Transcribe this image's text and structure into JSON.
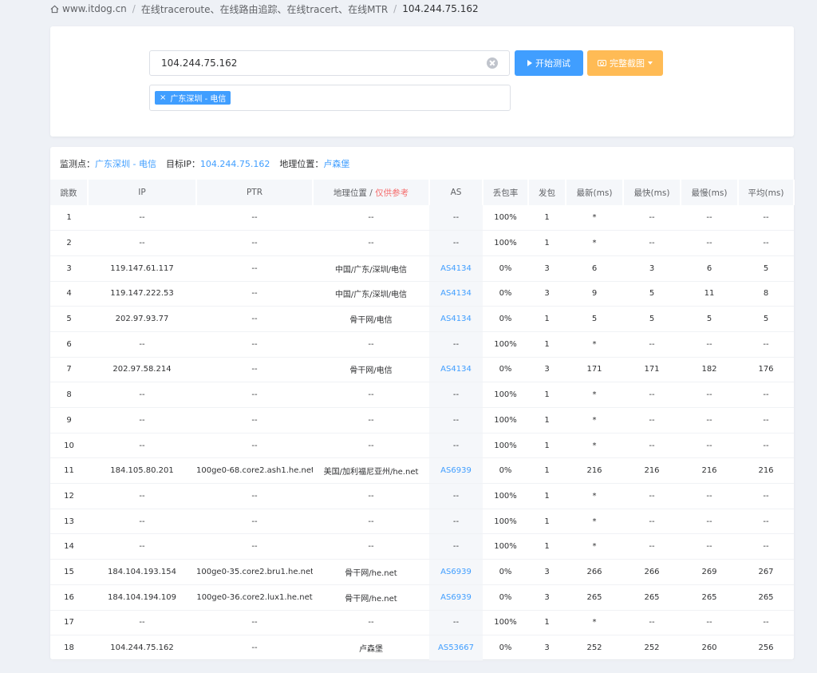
{
  "breadcrumb": {
    "home": "www.itdog.cn",
    "section": "在线traceroute、在线路由追踪、在线tracert、在线MTR",
    "current": "104.244.75.162"
  },
  "search": {
    "value": "104.244.75.162"
  },
  "buttons": {
    "start": "开始测试",
    "screenshot": "完整截图"
  },
  "selected_node": "广东深圳 - 电信",
  "info": {
    "node_label": "监测点：",
    "node_value": "广东深圳 - 电信",
    "target_label": "目标IP：",
    "target_value": "104.244.75.162",
    "geo_label": "地理位置：",
    "geo_value": "卢森堡"
  },
  "table": {
    "headers": {
      "hop": "跳数",
      "ip": "IP",
      "ptr": "PTR",
      "geo": "地理位置 / ",
      "geo_note": "仅供参考",
      "as": "AS",
      "loss": "丢包率",
      "sent": "发包",
      "last": "最新(ms)",
      "best": "最快(ms)",
      "worst": "最慢(ms)",
      "avg": "平均(ms)"
    },
    "rows": [
      {
        "hop": "1",
        "ip": "--",
        "ptr": "--",
        "geo": "--",
        "as": "--",
        "loss": "100%",
        "sent": "1",
        "last": "*",
        "best": "--",
        "worst": "--",
        "avg": "--"
      },
      {
        "hop": "2",
        "ip": "--",
        "ptr": "--",
        "geo": "--",
        "as": "--",
        "loss": "100%",
        "sent": "1",
        "last": "*",
        "best": "--",
        "worst": "--",
        "avg": "--"
      },
      {
        "hop": "3",
        "ip": "119.147.61.117",
        "ptr": "--",
        "geo": "中国/广东/深圳/电信",
        "as": "AS4134",
        "loss": "0%",
        "sent": "3",
        "last": "6",
        "best": "3",
        "worst": "6",
        "avg": "5"
      },
      {
        "hop": "4",
        "ip": "119.147.222.53",
        "ptr": "--",
        "geo": "中国/广东/深圳/电信",
        "as": "AS4134",
        "loss": "0%",
        "sent": "3",
        "last": "9",
        "best": "5",
        "worst": "11",
        "avg": "8"
      },
      {
        "hop": "5",
        "ip": "202.97.93.77",
        "ptr": "--",
        "geo": "骨干网/电信",
        "as": "AS4134",
        "loss": "0%",
        "sent": "1",
        "last": "5",
        "best": "5",
        "worst": "5",
        "avg": "5"
      },
      {
        "hop": "6",
        "ip": "--",
        "ptr": "--",
        "geo": "--",
        "as": "--",
        "loss": "100%",
        "sent": "1",
        "last": "*",
        "best": "--",
        "worst": "--",
        "avg": "--"
      },
      {
        "hop": "7",
        "ip": "202.97.58.214",
        "ptr": "--",
        "geo": "骨干网/电信",
        "as": "AS4134",
        "loss": "0%",
        "sent": "3",
        "last": "171",
        "best": "171",
        "worst": "182",
        "avg": "176"
      },
      {
        "hop": "8",
        "ip": "--",
        "ptr": "--",
        "geo": "--",
        "as": "--",
        "loss": "100%",
        "sent": "1",
        "last": "*",
        "best": "--",
        "worst": "--",
        "avg": "--"
      },
      {
        "hop": "9",
        "ip": "--",
        "ptr": "--",
        "geo": "--",
        "as": "--",
        "loss": "100%",
        "sent": "1",
        "last": "*",
        "best": "--",
        "worst": "--",
        "avg": "--"
      },
      {
        "hop": "10",
        "ip": "--",
        "ptr": "--",
        "geo": "--",
        "as": "--",
        "loss": "100%",
        "sent": "1",
        "last": "*",
        "best": "--",
        "worst": "--",
        "avg": "--"
      },
      {
        "hop": "11",
        "ip": "184.105.80.201",
        "ptr": "100ge0-68.core2.ash1.he.net",
        "geo": "美国/加利福尼亚州/he.net",
        "as": "AS6939",
        "loss": "0%",
        "sent": "1",
        "last": "216",
        "best": "216",
        "worst": "216",
        "avg": "216"
      },
      {
        "hop": "12",
        "ip": "--",
        "ptr": "--",
        "geo": "--",
        "as": "--",
        "loss": "100%",
        "sent": "1",
        "last": "*",
        "best": "--",
        "worst": "--",
        "avg": "--"
      },
      {
        "hop": "13",
        "ip": "--",
        "ptr": "--",
        "geo": "--",
        "as": "--",
        "loss": "100%",
        "sent": "1",
        "last": "*",
        "best": "--",
        "worst": "--",
        "avg": "--"
      },
      {
        "hop": "14",
        "ip": "--",
        "ptr": "--",
        "geo": "--",
        "as": "--",
        "loss": "100%",
        "sent": "1",
        "last": "*",
        "best": "--",
        "worst": "--",
        "avg": "--"
      },
      {
        "hop": "15",
        "ip": "184.104.193.154",
        "ptr": "100ge0-35.core2.bru1.he.net",
        "geo": "骨干网/he.net",
        "as": "AS6939",
        "loss": "0%",
        "sent": "3",
        "last": "266",
        "best": "266",
        "worst": "269",
        "avg": "267"
      },
      {
        "hop": "16",
        "ip": "184.104.194.109",
        "ptr": "100ge0-36.core2.lux1.he.net",
        "geo": "骨干网/he.net",
        "as": "AS6939",
        "loss": "0%",
        "sent": "3",
        "last": "265",
        "best": "265",
        "worst": "265",
        "avg": "265"
      },
      {
        "hop": "17",
        "ip": "--",
        "ptr": "--",
        "geo": "--",
        "as": "--",
        "loss": "100%",
        "sent": "1",
        "last": "*",
        "best": "--",
        "worst": "--",
        "avg": "--"
      },
      {
        "hop": "18",
        "ip": "104.244.75.162",
        "ptr": "--",
        "geo": "卢森堡",
        "as": "AS53667",
        "loss": "0%",
        "sent": "3",
        "last": "252",
        "best": "252",
        "worst": "260",
        "avg": "256"
      }
    ]
  }
}
